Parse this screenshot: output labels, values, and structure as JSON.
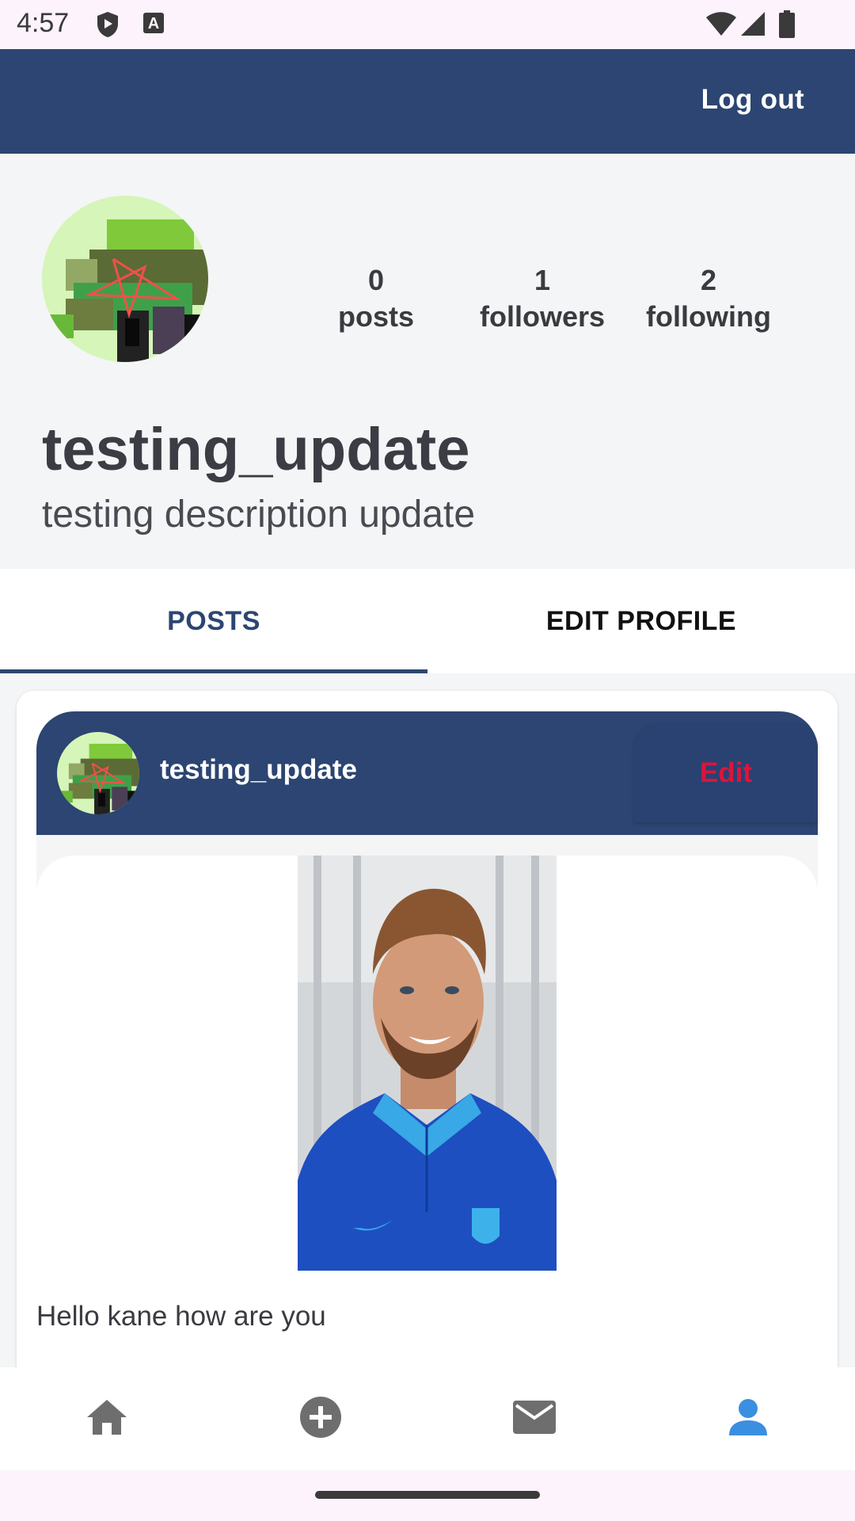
{
  "status_bar": {
    "time": "4:57",
    "icons": [
      "shield-icon",
      "font-a-icon",
      "wifi-icon",
      "signal-icon",
      "battery-icon"
    ]
  },
  "app_bar": {
    "logout_label": "Log out",
    "color": "#2c4572"
  },
  "profile": {
    "avatar": "pixel-art-avatar",
    "stats": [
      {
        "value": "0",
        "label": "posts"
      },
      {
        "value": "1",
        "label": "followers"
      },
      {
        "value": "2",
        "label": "following"
      }
    ],
    "username": "testing_update",
    "bio": "testing description update"
  },
  "tabs": [
    {
      "label": "POSTS",
      "active": true
    },
    {
      "label": "EDIT PROFILE",
      "active": false
    }
  ],
  "post": {
    "username": "testing_update",
    "edit_label": "Edit",
    "edit_color": "#dc143c",
    "image": "photo-of-man-in-blue-england-jersey",
    "caption": "Hello kane how are you"
  },
  "bottom_nav": [
    {
      "icon": "home-icon",
      "active": false
    },
    {
      "icon": "add-circle-icon",
      "active": false
    },
    {
      "icon": "mail-icon",
      "active": false
    },
    {
      "icon": "person-icon",
      "active": true
    }
  ],
  "colors": {
    "primary": "#2c4572",
    "active_nav": "#3b8fe0",
    "inactive_nav": "#6e6e6e"
  }
}
